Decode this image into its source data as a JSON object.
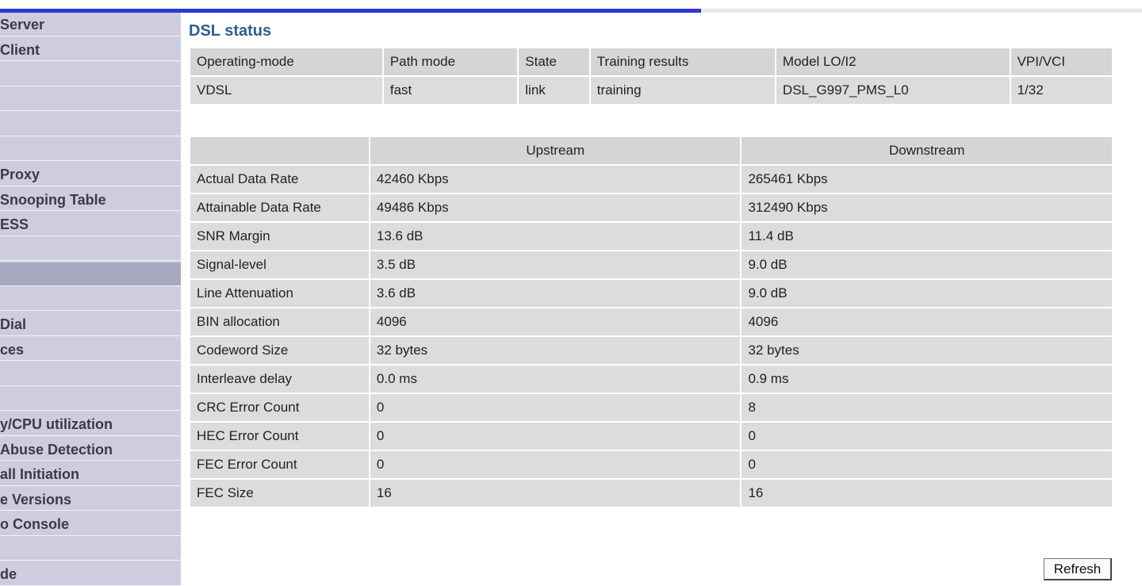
{
  "sidebar": {
    "items": [
      {
        "label": "Server",
        "header": false
      },
      {
        "label": "Client",
        "header": false
      },
      {
        "label": "",
        "header": false
      },
      {
        "label": "",
        "header": false
      },
      {
        "label": "",
        "header": false
      },
      {
        "label": "",
        "header": false
      },
      {
        "label": "Proxy",
        "header": false
      },
      {
        "label": "Snooping Table",
        "header": false
      },
      {
        "label": "ESS",
        "header": false
      },
      {
        "label": "",
        "header": false
      },
      {
        "label": "",
        "header": true
      },
      {
        "label": "",
        "header": false
      },
      {
        "label": "Dial",
        "header": false
      },
      {
        "label": "ces",
        "header": false
      },
      {
        "label": "",
        "header": false
      },
      {
        "label": "",
        "header": false
      },
      {
        "label": "y/CPU utilization",
        "header": false
      },
      {
        "label": "Abuse Detection",
        "header": false
      },
      {
        "label": "all Initiation",
        "header": false
      },
      {
        "label": "e Versions",
        "header": false
      },
      {
        "label": "o Console",
        "header": false
      },
      {
        "label": "",
        "header": false
      },
      {
        "label": "de",
        "header": false
      }
    ]
  },
  "page": {
    "title": "DSL status",
    "refresh_label": "Refresh"
  },
  "status_table": {
    "headers": [
      "Operating-mode",
      "Path mode",
      "State",
      "Training results",
      "Model LO/I2",
      "VPI/VCI"
    ],
    "row": [
      "VDSL",
      "fast",
      "link",
      "training",
      "DSL_G997_PMS_L0",
      "1/32"
    ]
  },
  "stats_table": {
    "headers": [
      "",
      "Upstream",
      "Downstream"
    ],
    "rows": [
      {
        "label": "Actual Data Rate",
        "up": "42460 Kbps",
        "down": "265461 Kbps"
      },
      {
        "label": "Attainable Data Rate",
        "up": "49486 Kbps",
        "down": "312490 Kbps"
      },
      {
        "label": "SNR Margin",
        "up": "13.6 dB",
        "down": "11.4 dB"
      },
      {
        "label": "Signal-level",
        "up": "3.5 dB",
        "down": "9.0 dB"
      },
      {
        "label": "Line Attenuation",
        "up": "3.6 dB",
        "down": "9.0 dB"
      },
      {
        "label": "BIN allocation",
        "up": "4096",
        "down": "4096"
      },
      {
        "label": "Codeword Size",
        "up": "32 bytes",
        "down": "32 bytes"
      },
      {
        "label": "Interleave delay",
        "up": "0.0 ms",
        "down": "0.9 ms"
      },
      {
        "label": "CRC Error Count",
        "up": "0",
        "down": "8"
      },
      {
        "label": "HEC Error Count",
        "up": "0",
        "down": "0"
      },
      {
        "label": "FEC Error Count",
        "up": "0",
        "down": "0"
      },
      {
        "label": "FEC Size",
        "up": "16",
        "down": "16"
      }
    ]
  },
  "progress": {
    "fraction": 0.614,
    "color": "#2f35d6"
  }
}
